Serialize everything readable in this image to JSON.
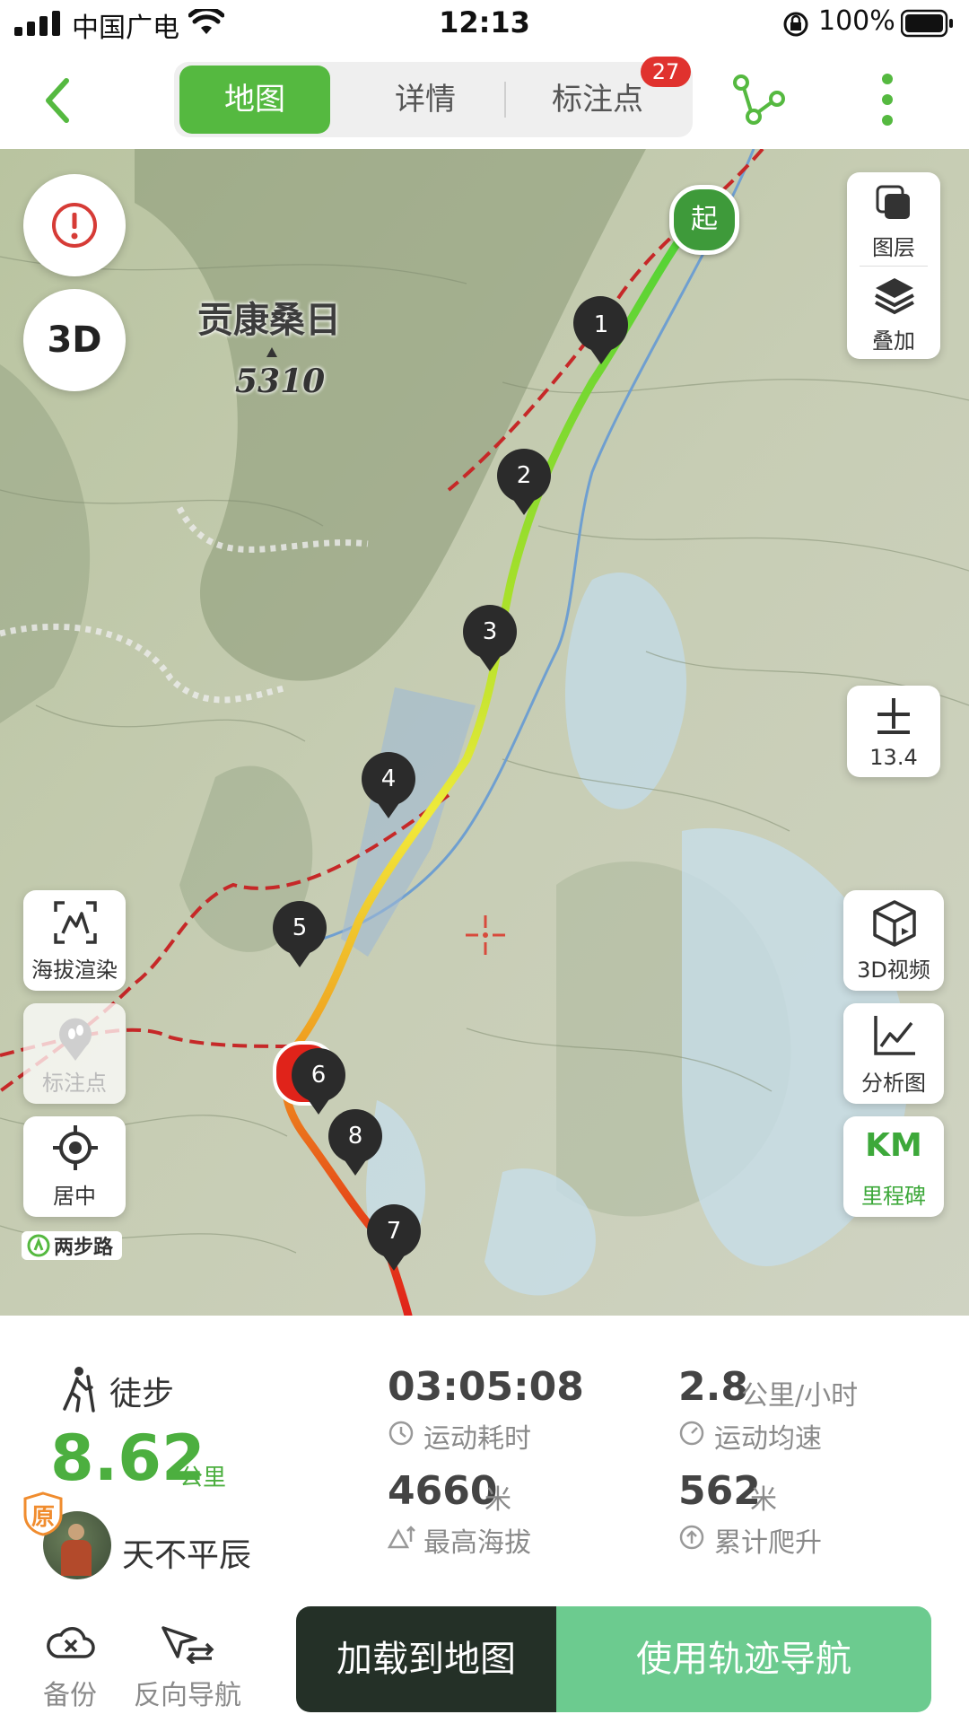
{
  "status_bar": {
    "carrier": "中国广电",
    "time": "12:13",
    "battery": "100%"
  },
  "nav": {
    "tabs": [
      {
        "label": "地图"
      },
      {
        "label": "详情"
      },
      {
        "label": "标注点",
        "badge": "27"
      }
    ],
    "back_icon": "chevron-left-icon",
    "share_icon": "share-nodes-icon",
    "more_icon": "more-vertical-icon",
    "accent_color": "#55b940"
  },
  "map": {
    "peak_name": "贡康桑日",
    "peak_elevation": "5310",
    "start_label": "起",
    "markers": [
      "1",
      "2",
      "3",
      "4",
      "5",
      "6",
      "8",
      "7"
    ],
    "layers_label": "图层",
    "overlay_label": "叠加",
    "zoom_level": "13.4",
    "elevation_render_label": "海拔渲染",
    "waypoints_label": "标注点",
    "center_label": "居中",
    "video_3d_label": "3D视频",
    "analysis_label": "分析图",
    "milestone_icon_text": "KM",
    "milestone_label": "里程碑",
    "brand_logo_text": "两步路",
    "btn_3d_text": "3D"
  },
  "stats": {
    "activity": "徒步",
    "distance": "8.62",
    "distance_unit": "公里",
    "duration": "03:05:08",
    "duration_label": "运动耗时",
    "avg_speed": "2.8",
    "avg_speed_unit": "公里/小时",
    "avg_speed_label": "运动均速",
    "max_elevation": "4660",
    "max_elevation_unit": "米",
    "max_elevation_label": "最高海拔",
    "total_climb": "562",
    "total_climb_unit": "米",
    "total_climb_label": "累计爬升",
    "author": "天不平辰",
    "original_badge": "原"
  },
  "bottom": {
    "backup_label": "备份",
    "reverse_nav_label": "反向导航",
    "load_to_map_label": "加载到地图",
    "use_track_nav_label": "使用轨迹导航"
  }
}
